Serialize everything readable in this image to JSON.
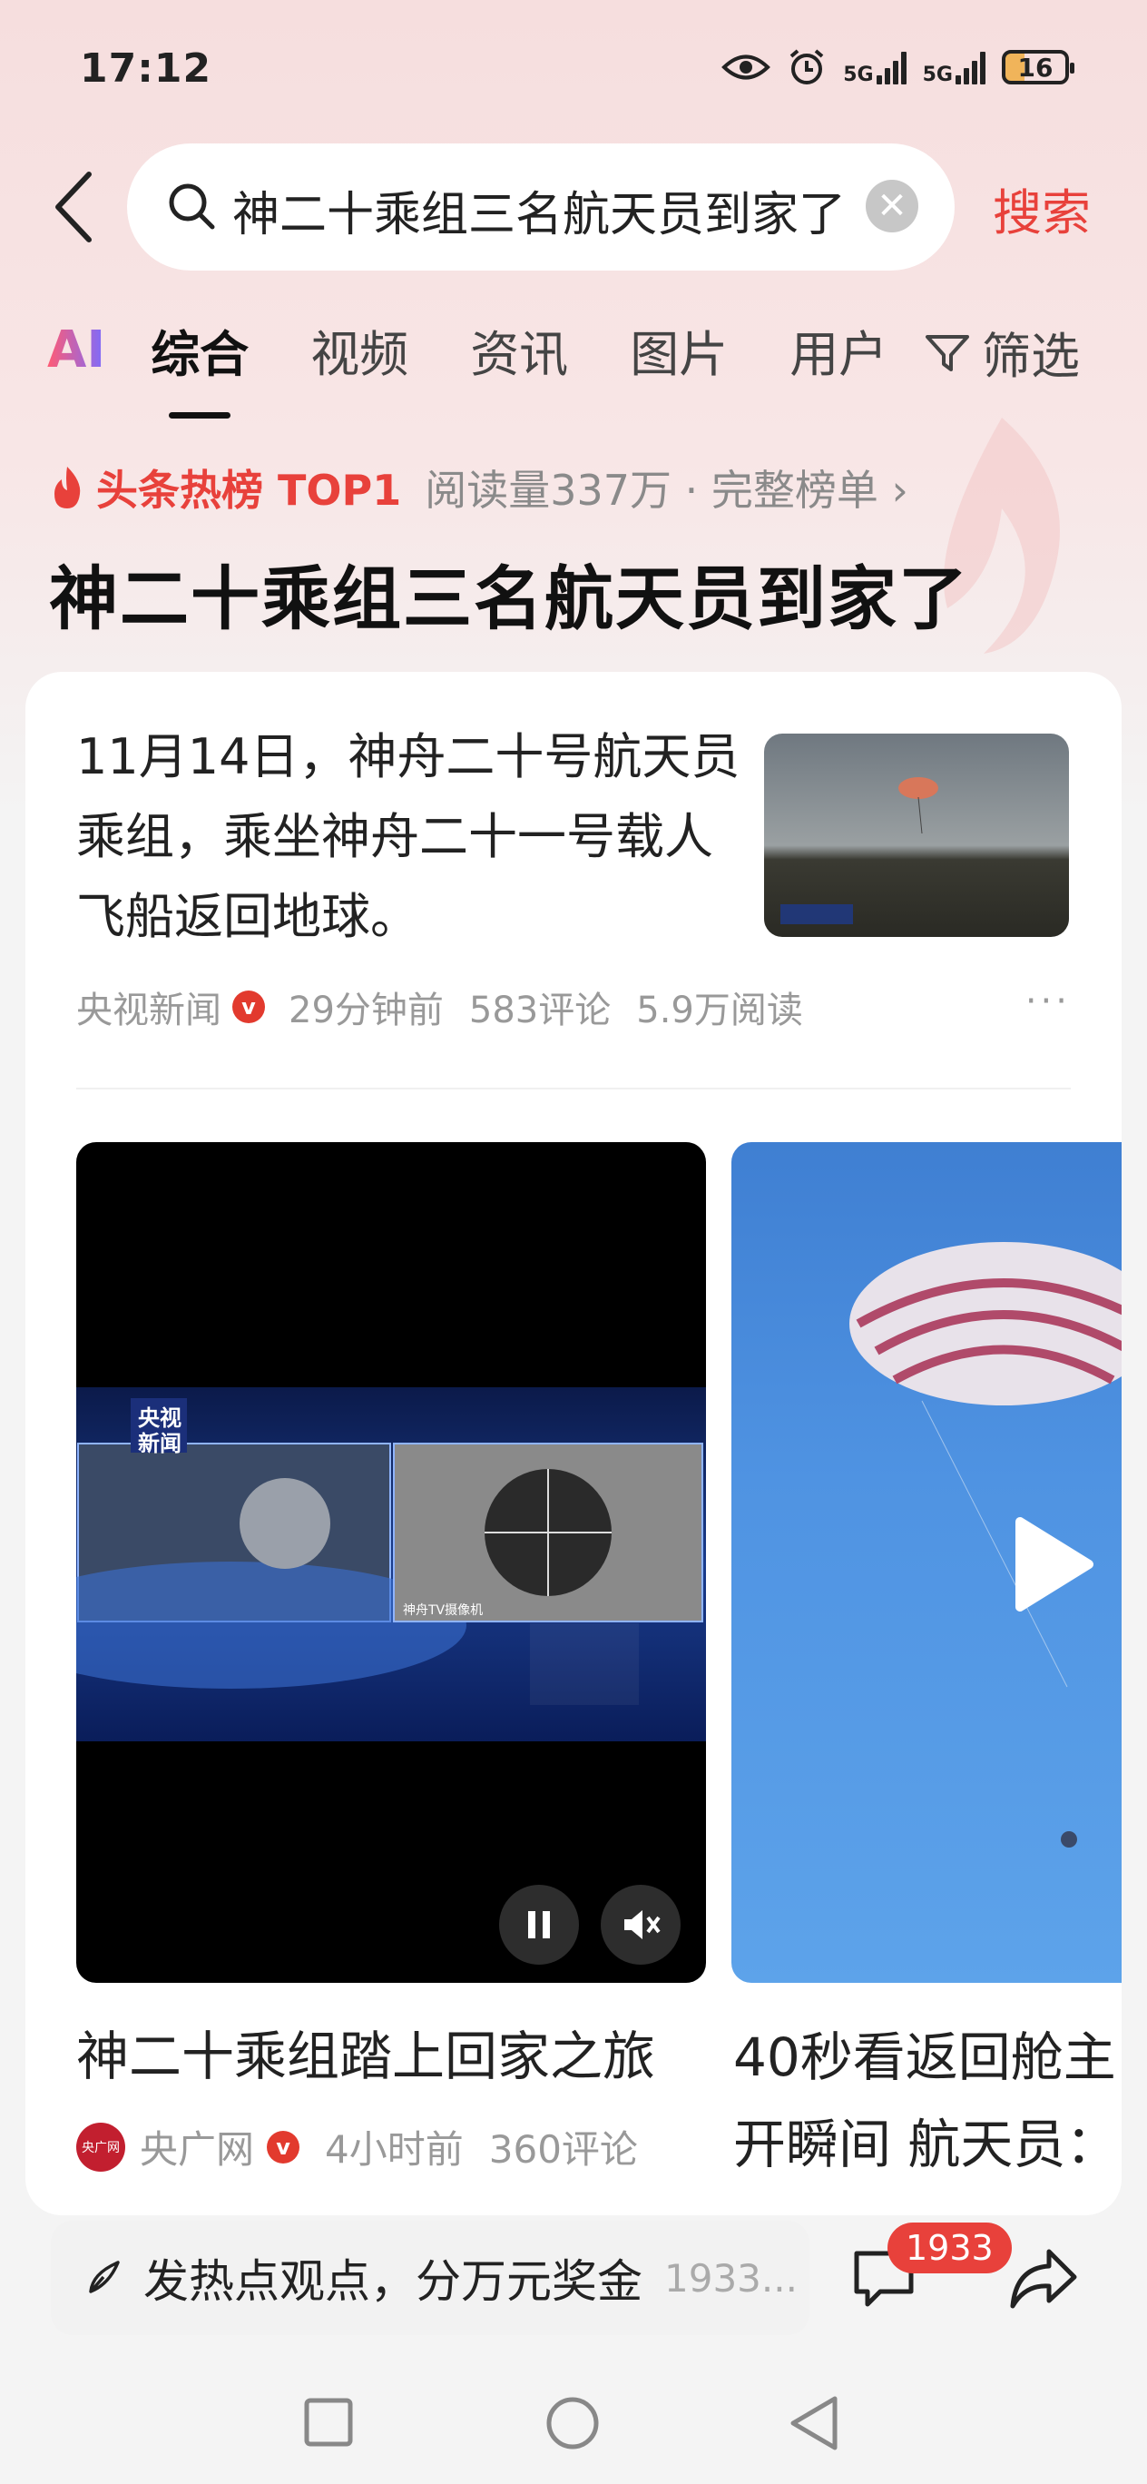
{
  "status_bar": {
    "time": "17:12",
    "signal1": "5G",
    "signal2": "5G",
    "battery": "16"
  },
  "search": {
    "query": "神二十乘组三名航天员到家了",
    "button": "搜索"
  },
  "tabs": {
    "ai": "AI",
    "items": [
      "综合",
      "视频",
      "资讯",
      "图片",
      "用户"
    ],
    "filter": "筛选"
  },
  "hot": {
    "title": "头条热榜 TOP1",
    "meta": "阅读量337万 · 完整榜单 ›"
  },
  "headline": "神二十乘组三名航天员到家了",
  "article": {
    "text": "11月14日，神舟二十号航天员乘组，乘坐神舟二十一号载人飞船返回地球。",
    "source": "央视新闻",
    "time": "29分钟前",
    "comments": "583评论",
    "reads": "5.9万阅读",
    "verified": "v"
  },
  "videos": [
    {
      "title": "神二十乘组踏上回家之旅",
      "source": "央广网",
      "time": "4小时前",
      "comments": "360评论",
      "logo": "央广网"
    },
    {
      "title": "40秒看返回舱主开瞬间 航天员："
    }
  ],
  "video_overlay": {
    "brand_line1": "央视",
    "brand_line2": "新闻",
    "cam_label": "神舟TV摄像机"
  },
  "bottom": {
    "comment_prompt": "发热点观点，分万元奖金",
    "comment_count": "1933...",
    "badge": "1933"
  },
  "colors": {
    "accent": "#e8413b",
    "bg_top": "#f6dede"
  }
}
